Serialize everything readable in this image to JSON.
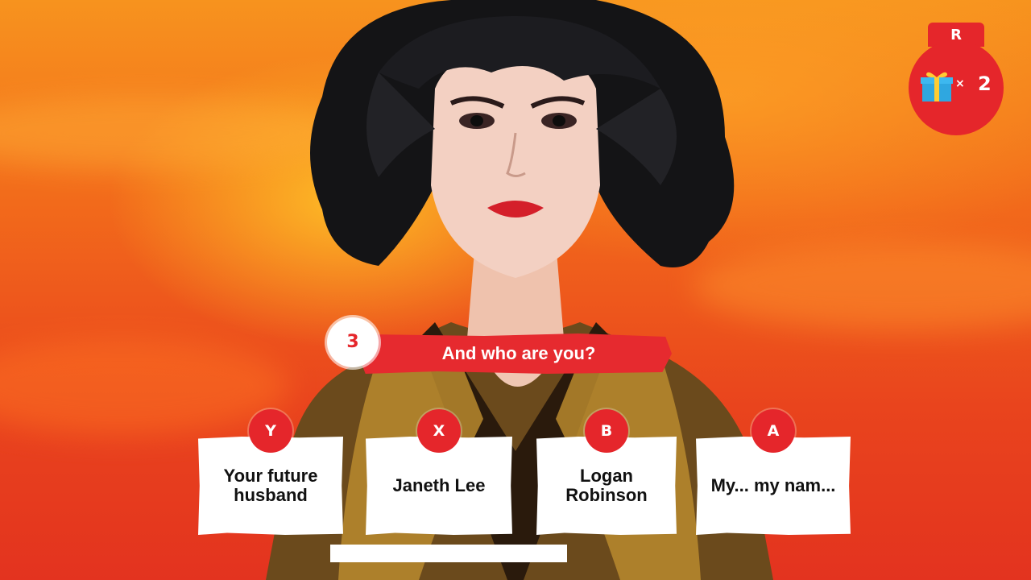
{
  "reward": {
    "key": "R",
    "icon": "gift-icon",
    "multiplier": "×",
    "count": "2"
  },
  "question": {
    "timer": "3",
    "text": "And who are you?"
  },
  "answers": [
    {
      "key": "Y",
      "text": "Your future husband"
    },
    {
      "key": "X",
      "text": "Janeth Lee"
    },
    {
      "key": "B",
      "text": "Logan Robinson"
    },
    {
      "key": "A",
      "text": "My... my nam..."
    }
  ],
  "timebar": {
    "remaining_fraction": 1.0
  },
  "colors": {
    "accent_red": "#e5262b",
    "card_white": "#ffffff",
    "background_orange": "#f26a1b"
  }
}
